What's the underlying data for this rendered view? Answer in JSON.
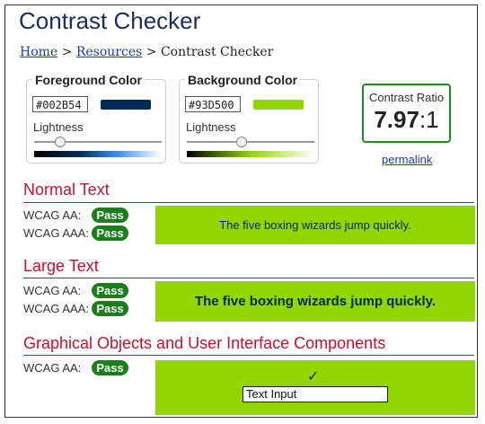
{
  "page": {
    "title": "Contrast Checker"
  },
  "breadcrumb": {
    "home": "Home",
    "sep1": ">",
    "resources": "Resources",
    "sep2": ">",
    "current": "Contrast Checker"
  },
  "foreground": {
    "legend": "Foreground Color",
    "hex": "#002B54",
    "swatch_color": "#002B54",
    "lightness_label": "Lightness",
    "lightness_level": 0.2
  },
  "background": {
    "legend": "Background Color",
    "hex": "#93D500",
    "swatch_color": "#93D500",
    "lightness_label": "Lightness",
    "lightness_level": 0.42
  },
  "ratio": {
    "label": "Contrast Ratio",
    "value": "7.97",
    "suffix": ":1",
    "permalink": "permalink"
  },
  "normal_text": {
    "heading": "Normal Text",
    "aa_label": "WCAG AA:",
    "aa_result": "Pass",
    "aaa_label": "WCAG AAA:",
    "aaa_result": "Pass",
    "sample": "The five boxing wizards jump quickly."
  },
  "large_text": {
    "heading": "Large Text",
    "aa_label": "WCAG AA:",
    "aa_result": "Pass",
    "aaa_label": "WCAG AAA:",
    "aaa_result": "Pass",
    "sample": "The five boxing wizards jump quickly."
  },
  "graphical": {
    "heading": "Graphical Objects and User Interface Components",
    "aa_label": "WCAG AA:",
    "aa_result": "Pass",
    "check_glyph": "✓",
    "input_value": "Text Input"
  },
  "colors": {
    "accent_red": "#c41230",
    "pass_green": "#1a7f1a",
    "link_blue": "#1a3f9b"
  },
  "icons": {
    "check": "checkmark-icon"
  }
}
